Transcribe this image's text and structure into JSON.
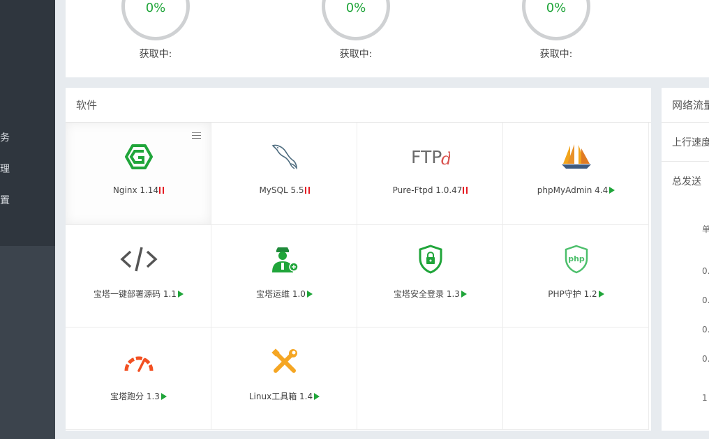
{
  "sidebar": {
    "items": [
      {
        "label": "务"
      },
      {
        "label": "理"
      },
      {
        "label": "置"
      }
    ]
  },
  "gauges": [
    {
      "percent": "0%",
      "caption": "获取中:"
    },
    {
      "percent": "0%",
      "caption": "获取中:"
    },
    {
      "percent": "0%",
      "caption": "获取中:"
    }
  ],
  "software": {
    "title": "软件",
    "items": [
      {
        "name": "Nginx 1.14",
        "status": "running",
        "icon": "nginx-icon"
      },
      {
        "name": "MySQL 5.5",
        "status": "running",
        "icon": "mysql-dolphin-icon"
      },
      {
        "name": "Pure-Ftpd 1.0.47",
        "status": "running",
        "icon": "ftpd-icon"
      },
      {
        "name": "phpMyAdmin 4.4",
        "status": "stopped",
        "icon": "sailboat-icon"
      },
      {
        "name": "宝塔一键部署源码 1.1",
        "status": "stopped",
        "icon": "code-icon"
      },
      {
        "name": "宝塔运维 1.0",
        "status": "stopped",
        "icon": "ops-worker-icon"
      },
      {
        "name": "宝塔安全登录 1.3",
        "status": "stopped",
        "icon": "shield-lock-icon"
      },
      {
        "name": "PHP守护 1.2",
        "status": "stopped",
        "icon": "php-shield-icon"
      },
      {
        "name": "宝塔跑分 1.3",
        "status": "stopped",
        "icon": "speedometer-icon"
      },
      {
        "name": "Linux工具箱 1.4",
        "status": "stopped",
        "icon": "tools-icon"
      }
    ]
  },
  "network": {
    "title": "网络流量",
    "upload_label": "上行速度",
    "total_sent_label": "总发送",
    "unit_label": "单",
    "ticks": [
      "0.",
      "0.",
      "0.",
      "0.",
      "1"
    ]
  },
  "colors": {
    "accent": "#20a53a",
    "danger": "#e51c23",
    "sidebar_bg": "#3c444d"
  }
}
